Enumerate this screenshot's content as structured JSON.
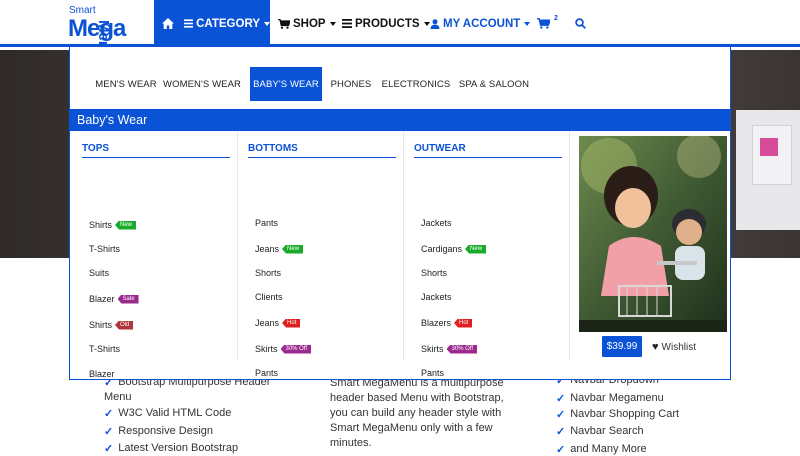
{
  "logo": {
    "small": "Smart",
    "big": "Mega",
    "side": "Menu"
  },
  "nav": {
    "category": "CATEGORY",
    "shop": "SHOP",
    "products": "PRODUCTS",
    "account": "MY ACCOUNT",
    "cart_count": "2"
  },
  "tabs": [
    "MEN'S WEAR",
    "WOMEN'S WEAR",
    "BABY'S WEAR",
    "PHONES",
    "ELECTRONICS",
    "SPA & SALOON"
  ],
  "section_title": "Baby's Wear",
  "columns": [
    {
      "title": "TOPS",
      "items": [
        {
          "label": "Shirts",
          "badge": "New"
        },
        {
          "label": "T-Shirts",
          "badge": ""
        },
        {
          "label": "Suits",
          "badge": ""
        },
        {
          "label": "Blazer",
          "badge": "Sale"
        },
        {
          "label": "Shirts",
          "badge": "Old"
        },
        {
          "label": "T-Shirts",
          "badge": ""
        },
        {
          "label": "Blazer",
          "badge": ""
        }
      ]
    },
    {
      "title": "BOTTOMS",
      "items": [
        {
          "label": "Pants",
          "badge": ""
        },
        {
          "label": "Jeans",
          "badge": "New"
        },
        {
          "label": "Shorts",
          "badge": ""
        },
        {
          "label": "Clients",
          "badge": ""
        },
        {
          "label": "Jeans",
          "badge": "Hot"
        },
        {
          "label": "Skirts",
          "badge": "30% Off"
        },
        {
          "label": "Pants",
          "badge": ""
        }
      ]
    },
    {
      "title": "OUTWEAR",
      "items": [
        {
          "label": "Jackets",
          "badge": ""
        },
        {
          "label": "Cardigans",
          "badge": "New"
        },
        {
          "label": "Shorts",
          "badge": ""
        },
        {
          "label": "Jackets",
          "badge": ""
        },
        {
          "label": "Blazers",
          "badge": "Hot"
        },
        {
          "label": "Skirts",
          "badge": "30% Off"
        },
        {
          "label": "Pants",
          "badge": ""
        }
      ]
    }
  ],
  "promo": {
    "price": "$39.99",
    "wishlist": "Wishlist"
  },
  "features_left": [
    "Bootstrap Multipurpose Header",
    "Menu",
    "W3C Valid HTML Code",
    "Responsive Design",
    "Latest Version Bootstrap"
  ],
  "features_mid": "Smart MegaMenu is a multipurpose header based Menu with Bootstrap, you can build any header style with Smart MegaMenu only with a few minutes.",
  "features_right": [
    "Navbar Dropdown",
    "Navbar Megamenu",
    "Navbar Shopping Cart",
    "Navbar Search",
    "and Many More"
  ],
  "colors": {
    "accent": "#0a52d6",
    "new": "#1aaa2a",
    "hot": "#e02020",
    "sale": "#9a2a8e",
    "old": "#b0343a"
  }
}
